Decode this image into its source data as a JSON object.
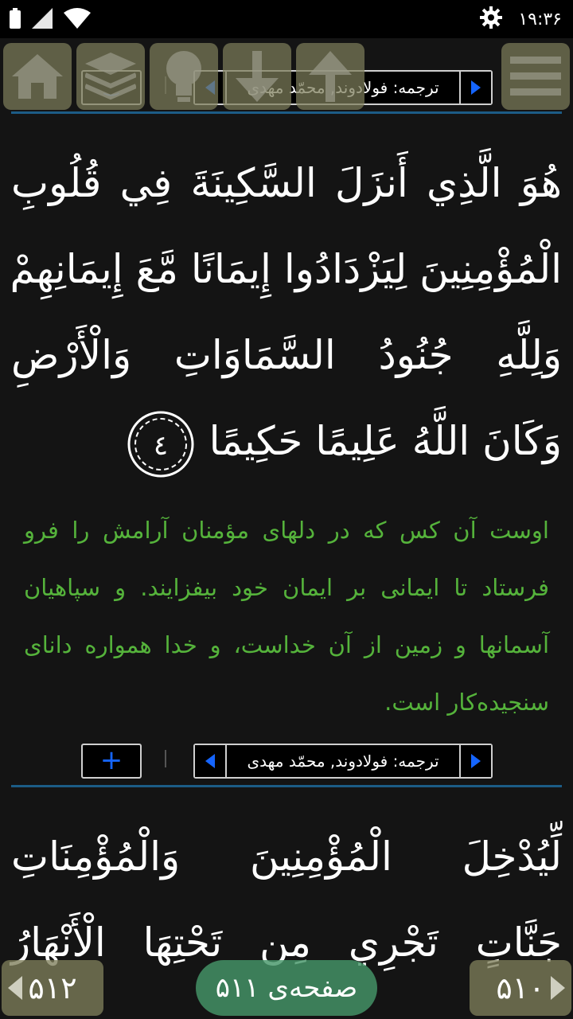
{
  "status_bar": {
    "time": "۱۹:۳۶",
    "icons": [
      "battery-icon",
      "signal-icon",
      "wifi-icon",
      "settings-gear-icon"
    ]
  },
  "toolbar": {
    "buttons": [
      "home-icon",
      "layers-icon",
      "lightbulb-icon",
      "arrow-down-icon",
      "arrow-up-icon",
      "menu-icon"
    ]
  },
  "translation_bar": {
    "label": "ترجمه: فولادوند, محمّد مهدی",
    "plus_label": "+"
  },
  "verse_4": {
    "lines": [
      "هُوَ الَّذِي أَنزَلَ السَّكِينَةَ فِي قُلُوبِ",
      "الْمُؤْمِنِينَ لِيَزْدَادُوا إِيمَانًا مَّعَ إِيمَانِهِمْ",
      "وَلِلَّهِ جُنُودُ السَّمَاوَاتِ وَالْأَرْضِ",
      "وَكَانَ اللَّهُ عَلِيمًا حَكِيمًا"
    ],
    "number": "٤"
  },
  "translation_4": "اوست آن کس که در دلهای مؤمنان آرامش را فرو فرستاد تا ایمانی بر ایمان خود بیفزایند. و سپاهیان آسمانها و زمین از آن خداست، و خدا همواره دانای سنجیده‌کار است.",
  "verse_5": {
    "lines": [
      "لِّيُدْخِلَ الْمُؤْمِنِينَ وَالْمُؤْمِنَاتِ",
      "جَنَّاتٍ تَجْرِي مِن تَحْتِهَا الْأَنْهَارُ"
    ]
  },
  "bottom_nav": {
    "prev_page": "۵۱۲",
    "next_page": "۵۱۰",
    "current_page": "صفحه‌ی ۵۱۱"
  },
  "colors": {
    "background": "#141414",
    "translation_text": "#55b33b",
    "divider": "#1c5c86",
    "accent_blue": "#1565ff"
  }
}
